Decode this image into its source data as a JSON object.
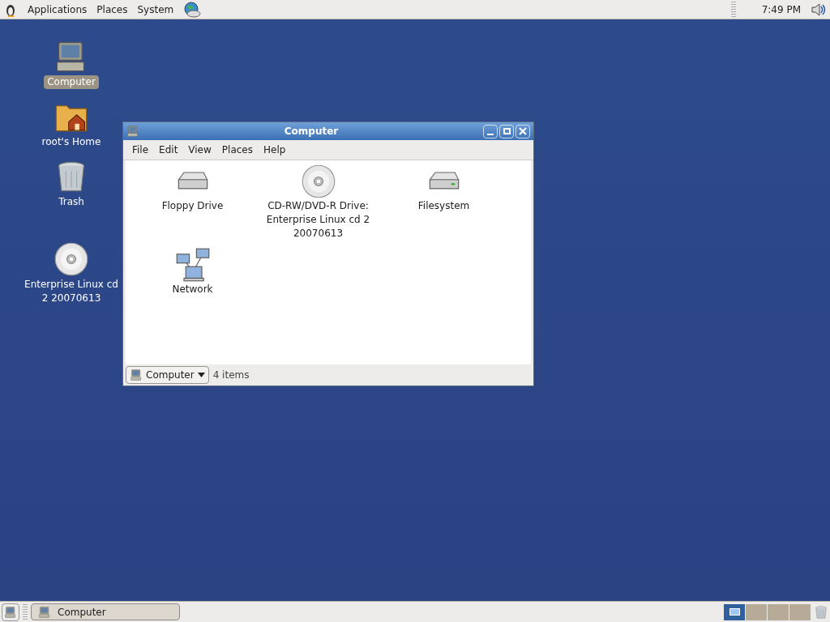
{
  "top_panel": {
    "menus": [
      "Applications",
      "Places",
      "System"
    ],
    "clock": "7:49 PM"
  },
  "desktop_icons": [
    {
      "kind": "computer",
      "label": "Computer",
      "selected": true
    },
    {
      "kind": "home",
      "label": "root's Home",
      "selected": false
    },
    {
      "kind": "trash",
      "label": "Trash",
      "selected": false
    },
    {
      "kind": "cdrom",
      "label": "Enterprise Linux cd 2 20070613",
      "selected": false
    }
  ],
  "window": {
    "title": "Computer",
    "menus": [
      "File",
      "Edit",
      "View",
      "Places",
      "Help"
    ],
    "items": [
      {
        "kind": "floppy",
        "label": "Floppy Drive"
      },
      {
        "kind": "cdrom",
        "label": "CD-RW/DVD-R Drive: Enterprise Linux cd 2 20070613"
      },
      {
        "kind": "disk",
        "label": "Filesystem"
      },
      {
        "kind": "network",
        "label": "Network"
      }
    ],
    "location": "Computer",
    "status": "4 items"
  },
  "bottom_panel": {
    "tasks": [
      {
        "label": "Computer"
      }
    ],
    "workspaces": [
      {
        "selected": true
      },
      {
        "selected": false
      },
      {
        "selected": false
      },
      {
        "selected": false
      }
    ]
  }
}
